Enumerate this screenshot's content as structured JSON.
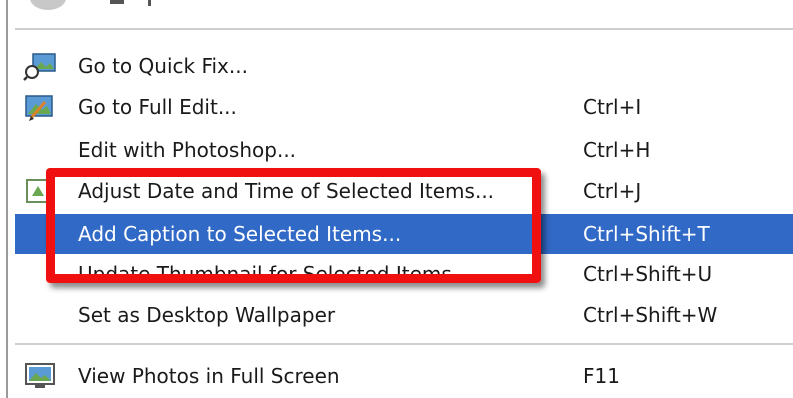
{
  "menu": {
    "items": [
      {
        "label": "Go to Quick Fix...",
        "shortcut": "",
        "icon": "quick-fix-icon"
      },
      {
        "label": "Go to Full Edit...",
        "shortcut": "Ctrl+I",
        "icon": "full-edit-icon"
      },
      {
        "label": "Edit with Photoshop...",
        "shortcut": "Ctrl+H",
        "icon": ""
      },
      {
        "label": "Adjust Date and Time of Selected Items...",
        "shortcut": "Ctrl+J",
        "icon": "date-time-icon"
      },
      {
        "label": "Add Caption to Selected Items...",
        "shortcut": "Ctrl+Shift+T",
        "icon": ""
      },
      {
        "label": "Update Thumbnail for Selected Items",
        "shortcut": "Ctrl+Shift+U",
        "icon": ""
      },
      {
        "label": "Set as Desktop Wallpaper",
        "shortcut": "Ctrl+Shift+W",
        "icon": ""
      },
      {
        "label": "View Photos in Full Screen",
        "shortcut": "F11",
        "icon": "full-screen-icon"
      }
    ]
  },
  "colors": {
    "highlight": "#3169c6",
    "annotation": "#f01010"
  }
}
